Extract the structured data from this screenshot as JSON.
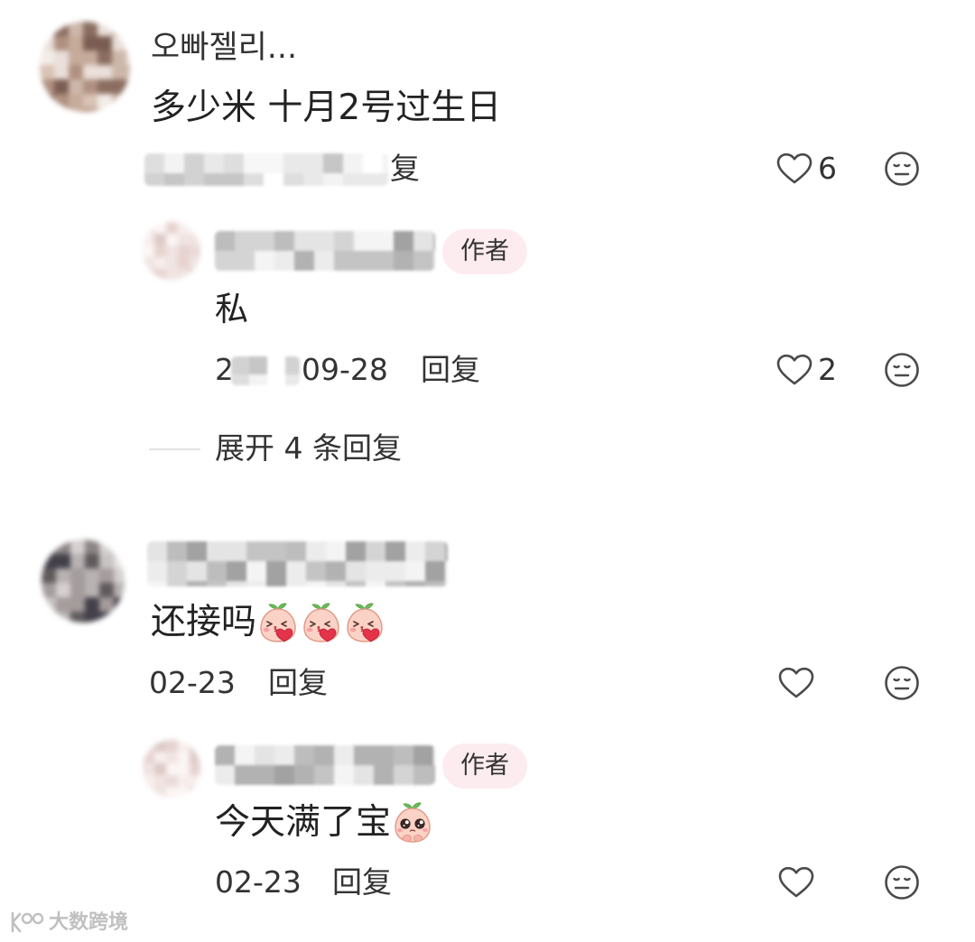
{
  "comments": [
    {
      "username": "오빠젤리...",
      "content": "多少米 十月2号过生日",
      "meta": {
        "reply_partial": "复"
      },
      "likes": "6",
      "replies": [
        {
          "badge": "作者",
          "content": "私",
          "date_start": "2",
          "date_end": "09-28",
          "reply_label": "回复",
          "likes": "2"
        }
      ],
      "expand_label": "展开 4 条回复"
    },
    {
      "content": "还接吗",
      "emojis": [
        "peach-kiss-heart-emoji",
        "peach-kiss-heart-emoji",
        "peach-kiss-heart-emoji"
      ],
      "date": "02-23",
      "reply_label": "回复",
      "replies": [
        {
          "badge": "作者",
          "content": "今天满了宝",
          "emojis": [
            "peach-pleading-emoji"
          ],
          "date": "02-23",
          "reply_label": "回复"
        }
      ]
    }
  ],
  "icons": {
    "like": "heart-outline-icon",
    "dislike": "meh-face-icon"
  },
  "colors": {
    "badge_bg": "#fdecef",
    "text": "#222222",
    "meta": "#333333",
    "icon_stroke": "#4a4a4a"
  },
  "watermark": {
    "text": "大数跨境",
    "logo": "watermark-logo-icon"
  }
}
